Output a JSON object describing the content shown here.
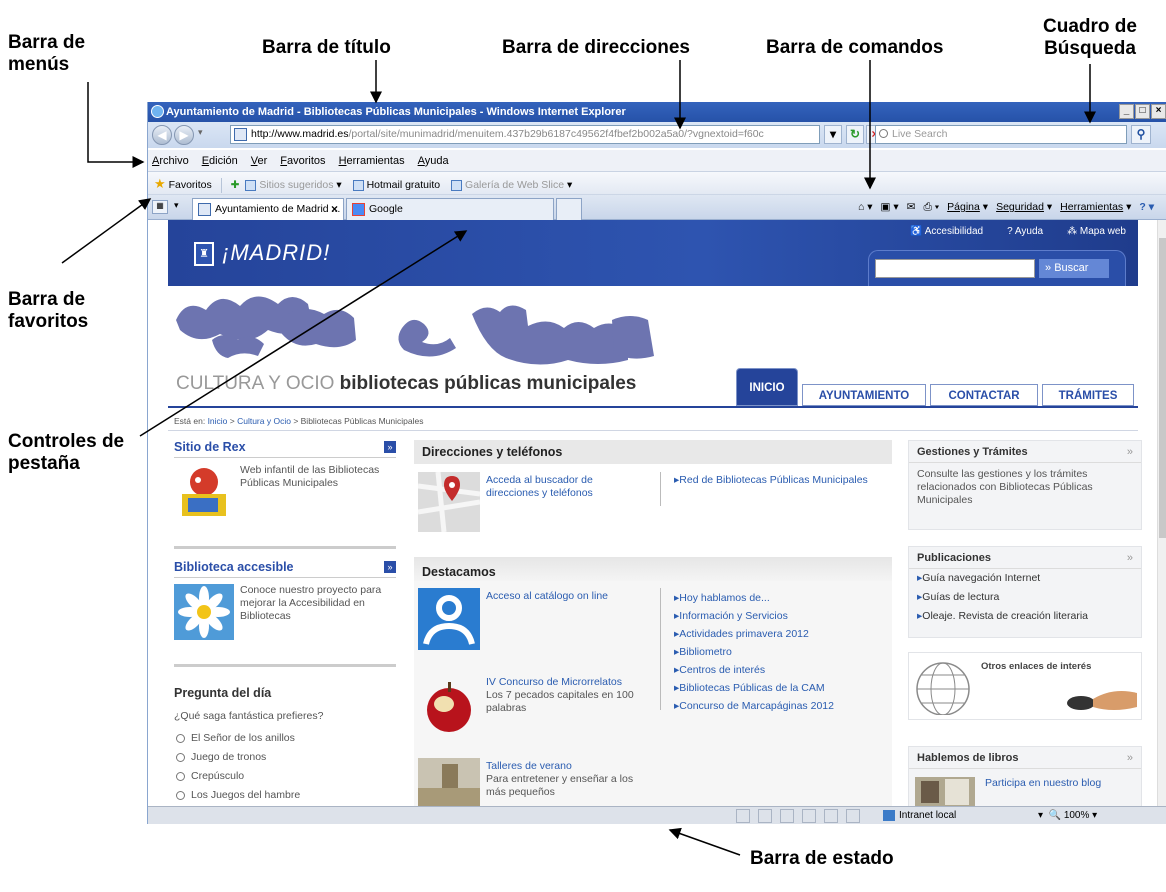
{
  "annotations": {
    "menu_bar": "Barra de menús",
    "title_bar": "Barra de título",
    "address_bar": "Barra de direcciones",
    "command_bar": "Barra de comandos",
    "search_box": "Cuadro de Búsqueda",
    "favorites_bar": "Barra de favoritos",
    "tab_controls": "Controles de pestaña",
    "status_bar": "Barra de estado"
  },
  "browser": {
    "window_title": "Ayuntamiento de Madrid - Bibliotecas Públicas Municipales - Windows Internet Explorer",
    "address_domain": "http://www.madrid.es",
    "address_path": "/portal/site/munimadrid/menuitem.437b29b6187c49562f4fbef2b002a5a0/?vgnextoid=f60c",
    "search_placeholder": "Live Search",
    "menu": [
      "Archivo",
      "Edición",
      "Ver",
      "Favoritos",
      "Herramientas",
      "Ayuda"
    ],
    "favorites": {
      "label": "Favoritos",
      "item1": "Sitios sugeridos",
      "item2": "Hotmail gratuito",
      "item3": "Galería de Web Slice"
    },
    "tabs": [
      "Ayuntamiento de Madrid ...",
      "Google"
    ],
    "commands": {
      "page": "Página",
      "security": "Seguridad",
      "tools": "Herramientas"
    },
    "status": {
      "zone": "Intranet local",
      "zoom": "100%"
    }
  },
  "site": {
    "logo": "¡MADRID!",
    "top_links": [
      "Accesibilidad",
      "Ayuda",
      "Mapa web"
    ],
    "search_button": "Buscar",
    "section_light": "CULTURA Y OCIO",
    "section_bold": "bibliotecas públicas municipales",
    "nav_tabs": [
      "INICIO",
      "AYUNTAMIENTO",
      "CONTACTAR",
      "TRÁMITES"
    ],
    "breadcrumb": {
      "prefix": "Está en:",
      "l1": "Inicio",
      "l2": "Cultura y Ocio",
      "current": "Bibliotecas Públicas Municipales"
    },
    "left": {
      "rex_title": "Sitio de Rex",
      "rex_text": "Web infantil de las Bibliotecas Públicas Municipales",
      "acc_title": "Biblioteca accesible",
      "acc_text": "Conoce nuestro proyecto para mejorar la Accesibilidad en Bibliotecas",
      "poll_title": "Pregunta del día",
      "poll_question": "¿Qué saga fantástica prefieres?",
      "poll_options": [
        "El Señor de los anillos",
        "Juego de tronos",
        "Crepúsculo",
        "Los Juegos del hambre"
      ]
    },
    "middle": {
      "dir_title": "Direcciones y teléfonos",
      "dir_link1": "Acceda al buscador de direcciones y teléfonos",
      "dir_link2": "Red de Bibliotecas Públicas Municipales",
      "dest_title": "Destacamos",
      "item1": "Acceso al catálogo on line",
      "item2_title": "IV Concurso de Microrrelatos",
      "item2_text": "Los 7 pecados capitales en 100 palabras",
      "item3_title": "Talleres de verano",
      "item3_text": "Para entretener y enseñar a los más pequeños",
      "list": [
        "Hoy hablamos de...",
        "Información y Servicios",
        "Actividades primavera 2012",
        "Bibliometro",
        "Centros de interés",
        "Bibliotecas Públicas de la CAM",
        "Concurso de Marcapáginas 2012"
      ]
    },
    "right": {
      "gest_title": "Gestiones y Trámites",
      "gest_text": "Consulte las gestiones y los trámites relacionados con Bibliotecas Públicas Municipales",
      "pub_title": "Publicaciones",
      "pub_items": [
        "Guía navegación Internet",
        "Guías de lectura",
        "Oleaje. Revista de creación literaria"
      ],
      "links_title": "Otros enlaces de interés",
      "books_title": "Hablemos de libros",
      "books_text": "Participa en nuestro blog"
    }
  },
  "colors": {
    "accent": "#25449a",
    "link": "#2a5cb0",
    "titlebar": "#2652a8"
  }
}
